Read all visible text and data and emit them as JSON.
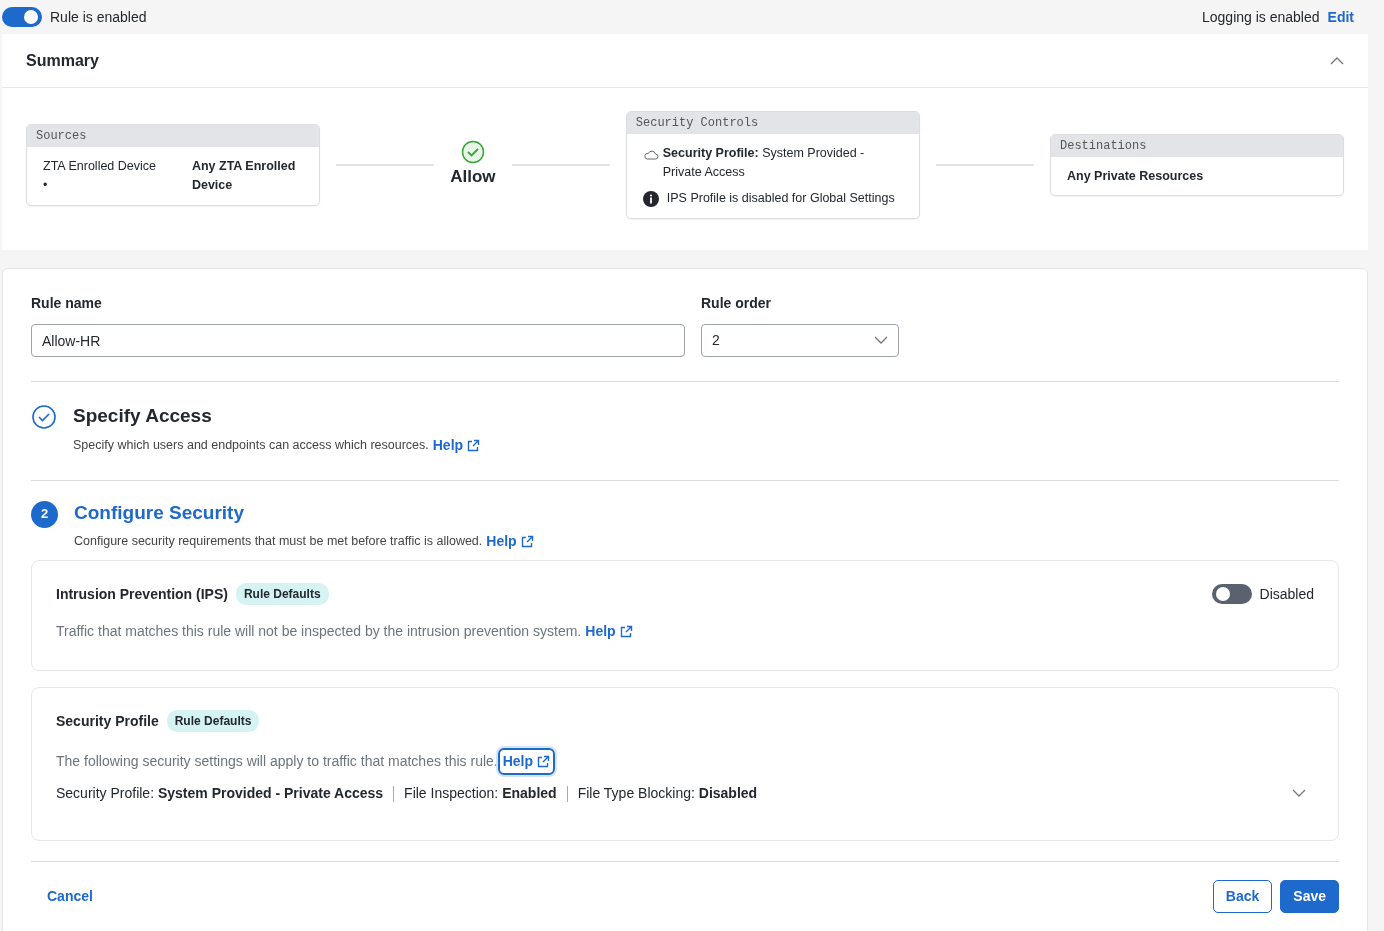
{
  "rule_toggle": {
    "label": "Rule is enabled",
    "on": true
  },
  "logging": {
    "text": "Logging is enabled",
    "edit": "Edit"
  },
  "summary": {
    "title": "Summary",
    "expanded": true,
    "sources": {
      "title": "Sources",
      "items": [
        {
          "label": "ZTA Enrolled Device",
          "marker": "•",
          "value": "Any ZTA Enrolled Device"
        }
      ]
    },
    "action": "Allow",
    "security_controls": {
      "title": "Security Controls",
      "profile_label": "Security Profile:",
      "profile_value": "System Provided - Private Access",
      "note": "IPS Profile is disabled for Global Settings"
    },
    "destinations": {
      "title": "Destinations",
      "items": [
        "Any Private Resources"
      ]
    }
  },
  "form": {
    "rule_name": {
      "label": "Rule name",
      "value": "Allow-HR"
    },
    "rule_order": {
      "label": "Rule order",
      "value": "2"
    }
  },
  "steps": [
    {
      "kind": "done",
      "title": "Specify Access",
      "description": "Specify which users and endpoints can access which resources.",
      "help": "Help"
    },
    {
      "kind": "active",
      "number": "2",
      "title": "Configure Security",
      "description": "Configure security requirements that must be met before traffic is allowed.",
      "help": "Help"
    }
  ],
  "ips": {
    "title": "Intrusion Prevention (IPS)",
    "badge": "Rule Defaults",
    "on": false,
    "state_label": "Disabled",
    "description": "Traffic that matches this rule will not be inspected by the intrusion prevention system.",
    "help": "Help"
  },
  "security_profile": {
    "title": "Security Profile",
    "badge": "Rule Defaults",
    "description": "The following security settings will apply to traffic that matches this rule.",
    "help": "Help",
    "help_focused": true,
    "expanded": false,
    "settings": [
      {
        "label": "Security Profile:",
        "value": "System Provided - Private Access"
      },
      {
        "label": "File Inspection:",
        "value": "Enabled"
      },
      {
        "label": "File Type Blocking:",
        "value": "Disabled"
      }
    ]
  },
  "footer": {
    "cancel": "Cancel",
    "back": "Back",
    "save": "Save"
  }
}
